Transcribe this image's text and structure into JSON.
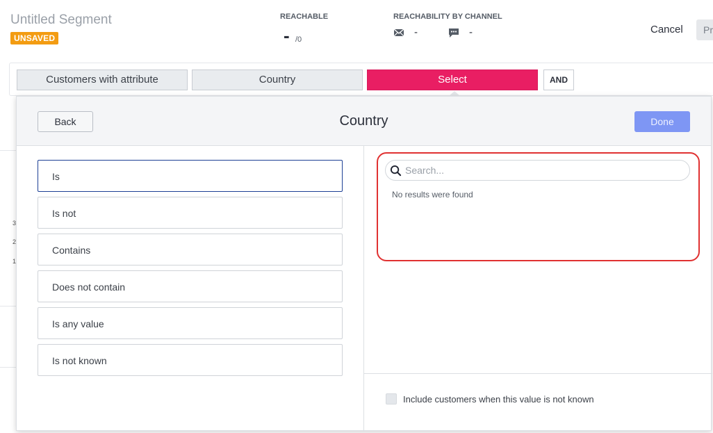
{
  "header": {
    "segment_title": "Untitled Segment",
    "status_badge": "UNSAVED",
    "reachable_label": "REACHABLE",
    "reachable_value": "-",
    "reachable_total": "/0",
    "reachability_label": "REACHABILITY BY CHANNEL",
    "channels": [
      {
        "icon": "envelope-icon",
        "value": "-"
      },
      {
        "icon": "chat-icon",
        "value": "-"
      }
    ],
    "cancel_label": "Cancel",
    "preview_label": "Pr"
  },
  "filter": {
    "chips": [
      "Customers with attribute",
      "Country",
      "Select"
    ],
    "and_label": "AND"
  },
  "modal": {
    "title": "Country",
    "back_label": "Back",
    "done_label": "Done",
    "operators": [
      "Is",
      "Is not",
      "Contains",
      "Does not contain",
      "Is any value",
      "Is not known"
    ],
    "selected_operator": "Is",
    "search_placeholder": "Search...",
    "no_results": "No results were found",
    "include_unknown_label": "Include customers when this value is not known",
    "include_unknown_checked": false
  },
  "background": {
    "ticks": [
      "3",
      "2",
      "1"
    ]
  },
  "colors": {
    "accent_pink": "#e91e63",
    "done_blue": "#7e96f4",
    "badge_orange": "#f39c12",
    "highlight_red": "#e03131"
  }
}
